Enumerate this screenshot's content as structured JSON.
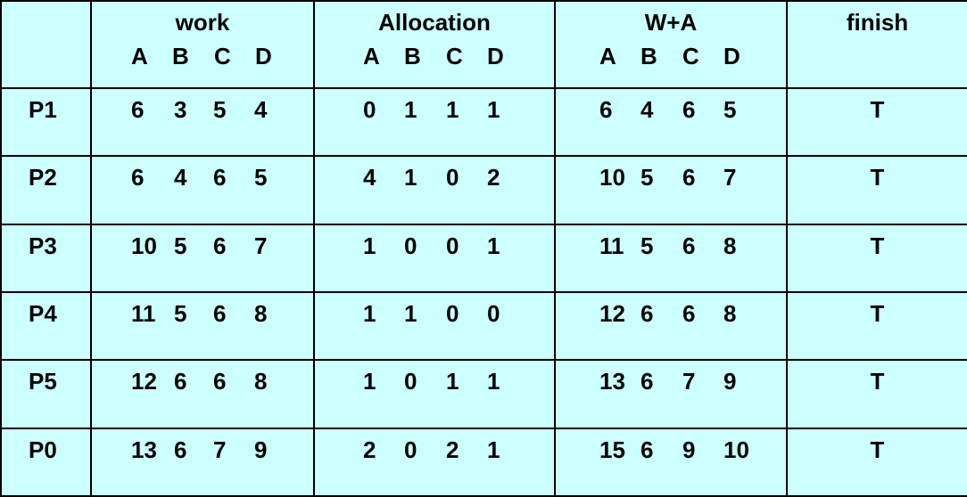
{
  "header": {
    "work": "work",
    "allocation": "Allocation",
    "wa": "W+A",
    "finish": "finish",
    "sub": [
      "A",
      "B",
      "C",
      "D"
    ]
  },
  "rows": [
    {
      "process": "P1",
      "work": [
        "6",
        "3",
        "5",
        "4"
      ],
      "allocation": [
        "0",
        "1",
        "1",
        "1"
      ],
      "wa": [
        "6",
        "4",
        "6",
        "5"
      ],
      "finish": "T"
    },
    {
      "process": "P2",
      "work": [
        "6",
        "4",
        "6",
        "5"
      ],
      "allocation": [
        "4",
        "1",
        "0",
        "2"
      ],
      "wa": [
        "10",
        "5",
        "6",
        "7"
      ],
      "finish": "T"
    },
    {
      "process": "P3",
      "work": [
        "10",
        "5",
        "6",
        "7"
      ],
      "allocation": [
        "1",
        "0",
        "0",
        "1"
      ],
      "wa": [
        "11",
        "5",
        "6",
        "8"
      ],
      "finish": "T"
    },
    {
      "process": "P4",
      "work": [
        "11",
        "5",
        "6",
        "8"
      ],
      "allocation": [
        "1",
        "1",
        "0",
        "0"
      ],
      "wa": [
        "12",
        "6",
        "6",
        "8"
      ],
      "finish": "T"
    },
    {
      "process": "P5",
      "work": [
        "12",
        "6",
        "6",
        "8"
      ],
      "allocation": [
        "1",
        "0",
        "1",
        "1"
      ],
      "wa": [
        "13",
        "6",
        "7",
        "9"
      ],
      "finish": "T"
    },
    {
      "process": "P0",
      "work": [
        "13",
        "6",
        "7",
        "9"
      ],
      "allocation": [
        "2",
        "0",
        "2",
        "1"
      ],
      "wa": [
        "15",
        "6",
        "9",
        "10"
      ],
      "finish": "T"
    }
  ],
  "colors": {
    "background": "#ccffff",
    "border": "#000000",
    "text": "#000000"
  }
}
